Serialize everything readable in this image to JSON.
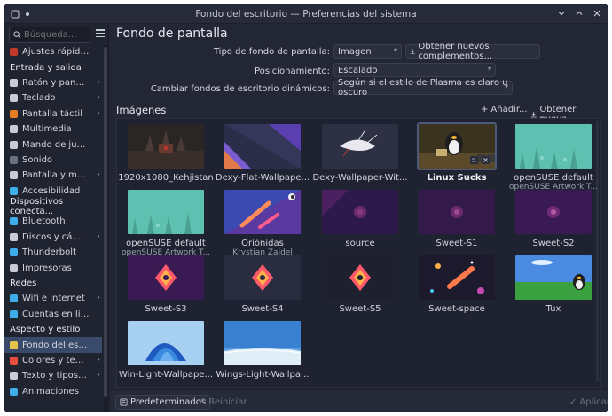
{
  "window": {
    "title": "Fondo del escritorio — Preferencias del sistema"
  },
  "sidebar": {
    "search_placeholder": "Búsqueda...",
    "items": [
      {
        "type": "item",
        "label": "Ajustes rápidos",
        "icon": "quick-settings-icon",
        "color": "#c0392b",
        "chevron": false
      },
      {
        "type": "header",
        "label": "Entrada y salida"
      },
      {
        "type": "item",
        "label": "Ratón y panel tá...",
        "icon": "mouse-icon",
        "color": "#c8ccd6",
        "chevron": true
      },
      {
        "type": "item",
        "label": "Teclado",
        "icon": "keyboard-icon",
        "color": "#c8ccd6",
        "chevron": true
      },
      {
        "type": "item",
        "label": "Pantalla táctil",
        "icon": "touchscreen-icon",
        "color": "#e67e22",
        "chevron": true
      },
      {
        "type": "item",
        "label": "Multimedia",
        "icon": "multimedia-icon",
        "color": "#c8ccd6",
        "chevron": false
      },
      {
        "type": "item",
        "label": "Mando de juego",
        "icon": "gamepad-icon",
        "color": "#c8ccd6",
        "chevron": false
      },
      {
        "type": "item",
        "label": "Sonido",
        "icon": "sound-icon",
        "color": "#6a7080",
        "chevron": false
      },
      {
        "type": "item",
        "label": "Pantalla y monitor",
        "icon": "monitor-icon",
        "color": "#c8ccd6",
        "chevron": true
      },
      {
        "type": "item",
        "label": "Accesibilidad",
        "icon": "accessibility-icon",
        "color": "#3daee9",
        "chevron": false
      },
      {
        "type": "header",
        "label": "Dispositivos conecta..."
      },
      {
        "type": "item",
        "label": "Bluetooth",
        "icon": "bluetooth-icon",
        "color": "#3daee9",
        "chevron": false
      },
      {
        "type": "item",
        "label": "Discos y cámaras",
        "icon": "disk-icon",
        "color": "#c8ccd6",
        "chevron": true
      },
      {
        "type": "item",
        "label": "Thunderbolt",
        "icon": "thunderbolt-icon",
        "color": "#3daee9",
        "chevron": false
      },
      {
        "type": "item",
        "label": "Impresoras",
        "icon": "printer-icon",
        "color": "#c8ccd6",
        "chevron": false
      },
      {
        "type": "header",
        "label": "Redes"
      },
      {
        "type": "item",
        "label": "Wifi e internet",
        "icon": "wifi-icon",
        "color": "#3daee9",
        "chevron": true
      },
      {
        "type": "item",
        "label": "Cuentas en línea",
        "icon": "online-accounts-icon",
        "color": "#3daee9",
        "chevron": false
      },
      {
        "type": "header",
        "label": "Aspecto y estilo"
      },
      {
        "type": "item",
        "label": "Fondo del escrit...",
        "icon": "wallpaper-icon",
        "color": "#e6c34a",
        "chevron": false,
        "active": true
      },
      {
        "type": "item",
        "label": "Colores y temas",
        "icon": "colors-icon",
        "color": "#e74c3c",
        "chevron": true
      },
      {
        "type": "item",
        "label": "Texto y tipos de l...",
        "icon": "fonts-icon",
        "color": "#c8ccd6",
        "chevron": true
      },
      {
        "type": "item",
        "label": "Animaciones",
        "icon": "animations-icon",
        "color": "#3daee9",
        "chevron": false
      }
    ]
  },
  "main": {
    "title": "Fondo de pantalla",
    "wallpaper_type_label": "Tipo de fondo de pantalla:",
    "wallpaper_type_value": "Imagen",
    "get_plugins_label": "Obtener nuevos complementos...",
    "positioning_label": "Posicionamiento:",
    "positioning_value": "Escalado",
    "dynamic_label": "Cambiar fondos de escritorio dinámicos:",
    "dynamic_value": "Según si el estilo de Plasma es claro u oscuro",
    "images_title": "Imágenes",
    "add_label": "Añadir...",
    "get_new_label": "Obtener nueva...",
    "thumbnails": [
      {
        "label": "1920x1080_Kehjistan",
        "sub": "",
        "style": "kehjistan"
      },
      {
        "label": "Dexy-Flat-Wallpape...",
        "sub": "",
        "style": "dexy"
      },
      {
        "label": "Dexy-Wallpaper-Wit...",
        "sub": "",
        "style": "dexywit"
      },
      {
        "label": "Linux Sucks",
        "sub": "",
        "style": "linuxsucks",
        "selected": true
      },
      {
        "label": "openSUSE default",
        "sub": "openSUSE Artwork T...",
        "style": "opensuse1"
      },
      {
        "label": "openSUSE default",
        "sub": "openSUSE Artwork T...",
        "style": "opensuse2"
      },
      {
        "label": "Oriónidas",
        "sub": "Krystian Zajdel",
        "style": "orionidas"
      },
      {
        "label": "source",
        "sub": "",
        "style": "source"
      },
      {
        "label": "Sweet-S1",
        "sub": "",
        "style": "sweets1"
      },
      {
        "label": "Sweet-S2",
        "sub": "",
        "style": "sweets2"
      },
      {
        "label": "Sweet-S3",
        "sub": "",
        "style": "sweets3"
      },
      {
        "label": "Sweet-S4",
        "sub": "",
        "style": "sweets4"
      },
      {
        "label": "Sweet-S5",
        "sub": "",
        "style": "sweets5"
      },
      {
        "label": "Sweet-space",
        "sub": "",
        "style": "sweetspace"
      },
      {
        "label": "Tux",
        "sub": "",
        "style": "tux"
      },
      {
        "label": "Win-Light-Wallpape...",
        "sub": "",
        "style": "winlight"
      },
      {
        "label": "Wings-Light-Wallpa...",
        "sub": "",
        "style": "wings"
      }
    ]
  },
  "footer": {
    "defaults_label": "Predeterminados",
    "reset_label": "Reiniciar",
    "apply_label": "Aplicar"
  }
}
